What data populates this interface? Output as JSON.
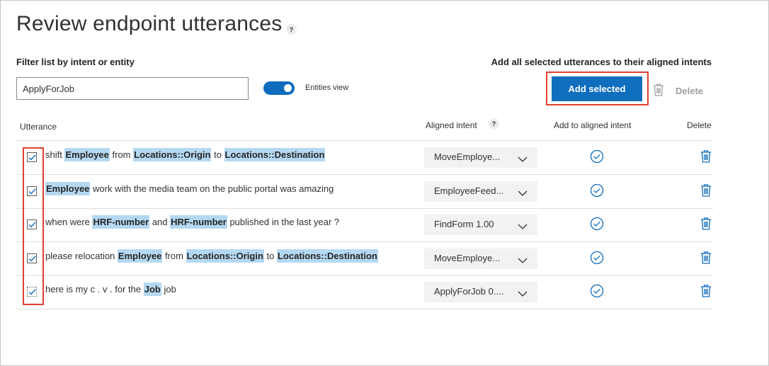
{
  "page": {
    "title": "Review endpoint utterances",
    "help_mark": "?"
  },
  "filter": {
    "label": "Filter list by intent or entity",
    "value": "ApplyForJob"
  },
  "entities_toggle": {
    "label": "Entities view",
    "on": true
  },
  "bulk": {
    "label": "Add all selected utterances to their aligned intents",
    "add_selected_label": "Add selected",
    "delete_label": "Delete"
  },
  "table": {
    "headers": {
      "utterance": "Utterance",
      "aligned_intent": "Aligned intent",
      "add_to_aligned": "Add to aligned intent",
      "delete": "Delete"
    },
    "rows": [
      {
        "checked": true,
        "segments": [
          {
            "t": "shift ",
            "ent": false
          },
          {
            "t": "Employee",
            "ent": true
          },
          {
            "t": " from ",
            "ent": false
          },
          {
            "t": "Locations::Origin",
            "ent": true
          },
          {
            "t": " to ",
            "ent": false
          },
          {
            "t": "Locations::Destination",
            "ent": true
          }
        ],
        "intent": "MoveEmploye..."
      },
      {
        "checked": true,
        "segments": [
          {
            "t": "Employee",
            "ent": true
          },
          {
            "t": " work with the media team on the public portal was amazing",
            "ent": false
          }
        ],
        "intent": "EmployeeFeed..."
      },
      {
        "checked": true,
        "segments": [
          {
            "t": "when were ",
            "ent": false
          },
          {
            "t": "HRF-number",
            "ent": true
          },
          {
            "t": " and ",
            "ent": false
          },
          {
            "t": "HRF-number",
            "ent": true
          },
          {
            "t": " published in the last year ?",
            "ent": false
          }
        ],
        "intent": "FindForm 1.00"
      },
      {
        "checked": true,
        "segments": [
          {
            "t": "please relocation ",
            "ent": false
          },
          {
            "t": "Employee",
            "ent": true
          },
          {
            "t": " from ",
            "ent": false
          },
          {
            "t": "Locations::Origin",
            "ent": true
          },
          {
            "t": " to ",
            "ent": false
          },
          {
            "t": "Locations::Destination",
            "ent": true
          }
        ],
        "intent": "MoveEmploye..."
      },
      {
        "checked": true,
        "segments": [
          {
            "t": "here is my c . v . for the ",
            "ent": false
          },
          {
            "t": "Job",
            "ent": true
          },
          {
            "t": " job",
            "ent": false
          }
        ],
        "intent": "ApplyForJob 0...."
      }
    ]
  },
  "colors": {
    "accent": "#106ebe",
    "entity_highlight": "#b4d8f2",
    "highlight_border": "#e0402f"
  },
  "icons": {
    "checkbox": "checkbox-checked-icon",
    "dropdown": "chevron-down-icon",
    "add": "check-circle-icon",
    "delete": "trash-icon",
    "help": "help-icon"
  }
}
